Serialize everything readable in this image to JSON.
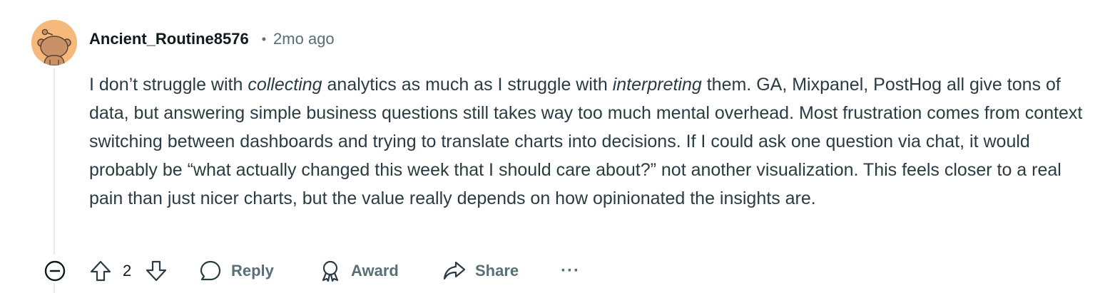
{
  "comment": {
    "author": "Ancient_Routine8576",
    "separator": "•",
    "timestamp": "2mo ago",
    "body": {
      "seg1": "I don’t struggle with ",
      "em1": "collecting",
      "seg2": " analytics as much as I struggle with ",
      "em2": "interpreting",
      "seg3": " them. GA, Mixpanel, PostHog all give tons of data, but answering simple business questions still takes way too much mental overhead. Most frustration comes from context switching between dashboards and trying to translate charts into decisions. If I could ask one question via chat, it would probably be “what actually changed this week that I should care about?” not another visualization. This feels closer to a real pain than just nicer charts, but the value really depends on how opinionated the insights are."
    },
    "score": "2"
  },
  "actions": {
    "reply_label": "Reply",
    "award_label": "Award",
    "share_label": "Share",
    "more_label": "···"
  },
  "icons": {
    "collapse": "minus-circle-icon",
    "upvote": "arrow-up-icon",
    "downvote": "arrow-down-icon",
    "reply": "speech-bubble-icon",
    "award": "award-ribbon-icon",
    "share": "share-arrow-icon"
  },
  "colors": {
    "avatar_bg": "#f5b97b",
    "text_primary": "#0f1a1c",
    "text_body": "#2a3c42",
    "text_meta": "#576f76",
    "thread_line": "#e5ebee"
  }
}
